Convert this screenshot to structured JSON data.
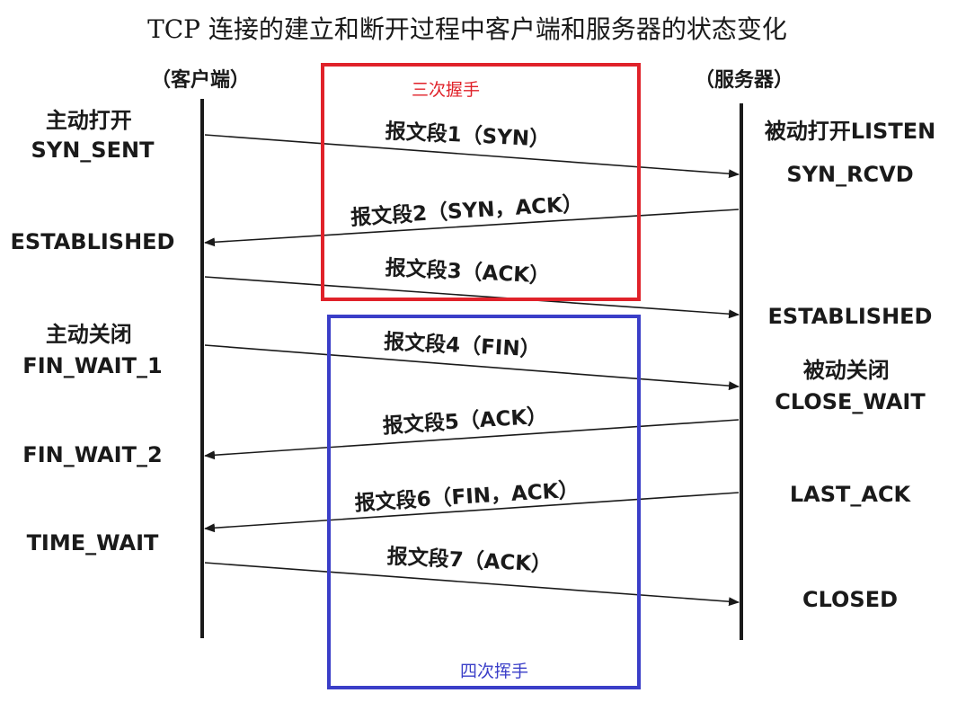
{
  "title": "TCP 连接的建立和断开过程中客户端和服务器的状态变化",
  "client": {
    "header": "（客户端）",
    "states": [
      {
        "lines": [
          "主动打开",
          "SYN_SENT"
        ]
      },
      {
        "lines": [
          "ESTABLISHED"
        ]
      },
      {
        "lines": [
          "主动关闭",
          "FIN_WAIT_1"
        ]
      },
      {
        "lines": [
          "FIN_WAIT_2"
        ]
      },
      {
        "lines": [
          "TIME_WAIT"
        ]
      }
    ]
  },
  "server": {
    "header": "（服务器）",
    "states": [
      {
        "lines": [
          "被动打开LISTEN"
        ]
      },
      {
        "lines": [
          "SYN_RCVD"
        ]
      },
      {
        "lines": [
          "ESTABLISHED"
        ]
      },
      {
        "lines": [
          "被动关闭",
          "CLOSE_WAIT"
        ]
      },
      {
        "lines": [
          "LAST_ACK"
        ]
      },
      {
        "lines": [
          "CLOSED"
        ]
      }
    ]
  },
  "segments": [
    {
      "label": "报文段1（SYN）",
      "direction": "client-to-server"
    },
    {
      "label": "报文段2（SYN，ACK）",
      "direction": "server-to-client"
    },
    {
      "label": "报文段3（ACK）",
      "direction": "client-to-server"
    },
    {
      "label": "报文段4（FIN）",
      "direction": "client-to-server"
    },
    {
      "label": "报文段5（ACK）",
      "direction": "server-to-client"
    },
    {
      "label": "报文段6（FIN，ACK）",
      "direction": "server-to-client"
    },
    {
      "label": "报文段7（ACK）",
      "direction": "client-to-server"
    }
  ],
  "boxes": {
    "handshake": {
      "label": "三次握手",
      "color": "#e0222a"
    },
    "wave": {
      "label": "四次挥手",
      "color": "#3a3ec8"
    }
  },
  "colors": {
    "ink": "#1a1a1a"
  }
}
